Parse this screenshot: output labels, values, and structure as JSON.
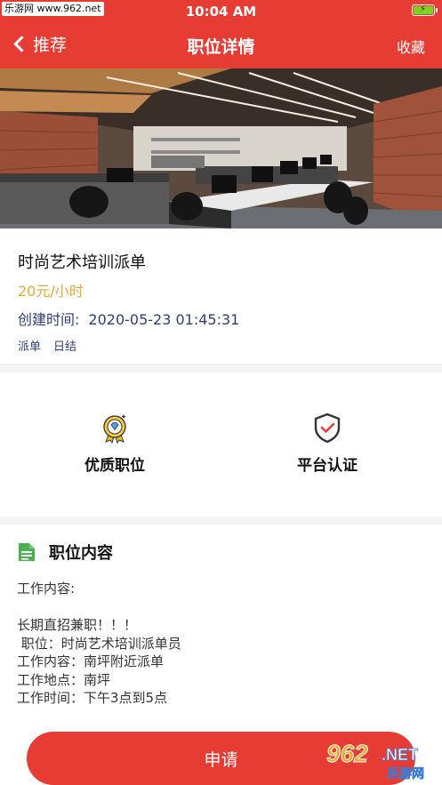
{
  "status_bar": {
    "watermark": "乐游网 www.962.net",
    "time": "10:04 AM"
  },
  "nav": {
    "back_label": "推荐",
    "title": "职位详情",
    "favorite_label": "收藏"
  },
  "job": {
    "title": "时尚艺术培训派单",
    "salary": "20元/小时",
    "created_label": "创建时间:",
    "created_value": "2020-05-23 01:45:31",
    "tags": [
      "派单",
      "日结"
    ]
  },
  "features": {
    "quality": "优质职位",
    "certified": "平台认证"
  },
  "content": {
    "section_title": "职位内容",
    "lines": [
      "工作内容:",
      "",
      "长期直招兼职！！！",
      " 职位：时尚艺术培训派单员",
      "工作内容：南坪附近派单",
      "工作地点：南坪",
      "工作时间：下午3点到5点"
    ]
  },
  "apply_label": "申请",
  "watermark_br": {
    "logo": "962",
    "net": ".NET",
    "site": "乐游网"
  },
  "colors": {
    "brand_red": "#e63c33",
    "salary_orange": "#e9a93a",
    "info_blue": "#2f3e7a",
    "doc_green": "#4caf50"
  }
}
